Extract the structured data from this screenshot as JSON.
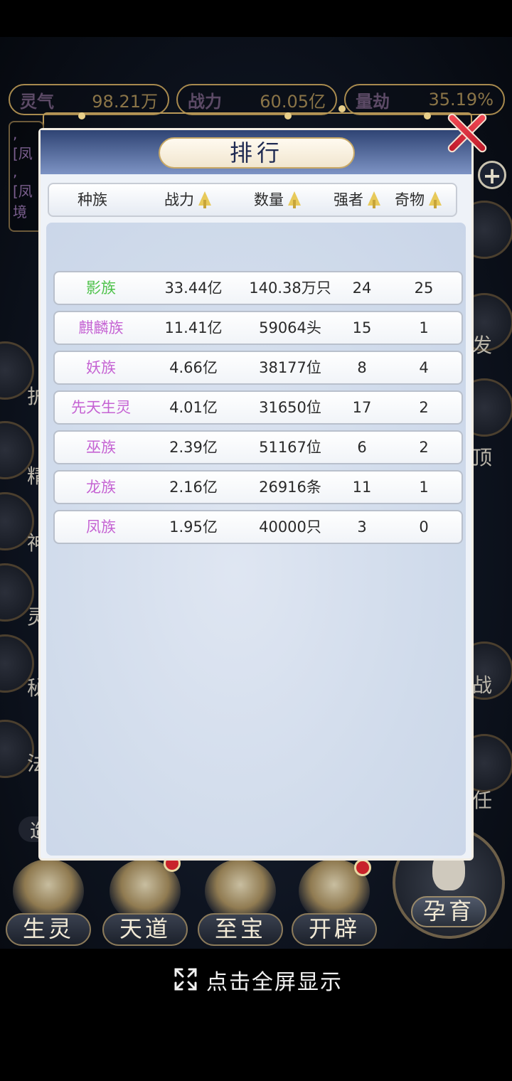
{
  "top_stats": [
    {
      "label": "灵气",
      "value": "98.21万"
    },
    {
      "label": "战力",
      "value": "60.05亿"
    },
    {
      "label": "量劫",
      "value": "35.19%"
    }
  ],
  "background_side_chars": {
    "left": [
      "护",
      "精",
      "神",
      "灵",
      "秘",
      "法"
    ],
    "right": [
      "发",
      "顶",
      "战",
      "任"
    ]
  },
  "left_panel_text": ", [凤 , [凤 境",
  "bottom_nav": [
    {
      "label": "生灵",
      "has_badge": false
    },
    {
      "label": "天道",
      "has_badge": true
    },
    {
      "label": "至宝",
      "has_badge": false
    },
    {
      "label": "开辟",
      "has_badge": true
    }
  ],
  "main_action": "孕育",
  "creation_label": "造物",
  "modal": {
    "title": "排行",
    "columns": [
      "种族",
      "战力",
      "数量",
      "强者",
      "奇物"
    ],
    "rows": [
      {
        "name": "影族",
        "name_color": "#4ec24a",
        "power": "33.44亿",
        "count": "140.38万只",
        "strong": "24",
        "treasure": "25"
      },
      {
        "name": "麒麟族",
        "name_color": "#c563d3",
        "power": "11.41亿",
        "count": "59064头",
        "strong": "15",
        "treasure": "1"
      },
      {
        "name": "妖族",
        "name_color": "#c563d3",
        "power": "4.66亿",
        "count": "38177位",
        "strong": "8",
        "treasure": "4"
      },
      {
        "name": "先天生灵",
        "name_color": "#c563d3",
        "power": "4.01亿",
        "count": "31650位",
        "strong": "17",
        "treasure": "2"
      },
      {
        "name": "巫族",
        "name_color": "#c563d3",
        "power": "2.39亿",
        "count": "51167位",
        "strong": "6",
        "treasure": "2"
      },
      {
        "name": "龙族",
        "name_color": "#c563d3",
        "power": "2.16亿",
        "count": "26916条",
        "strong": "11",
        "treasure": "1"
      },
      {
        "name": "凤族",
        "name_color": "#c563d3",
        "power": "1.95亿",
        "count": "40000只",
        "strong": "3",
        "treasure": "0"
      }
    ]
  },
  "footer": {
    "fullscreen_text": "点击全屏显示",
    "icon": "fullscreen-expand-icon"
  },
  "colors": {
    "accent_gold": "#b89858",
    "modal_header": "#2f4474",
    "close_red": "#d0222f"
  }
}
